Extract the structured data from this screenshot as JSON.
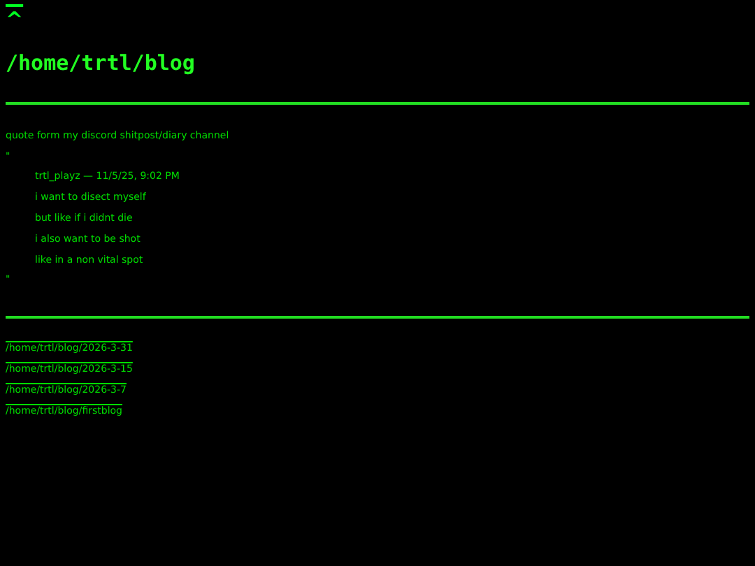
{
  "back_link": "^",
  "title": "/home/trtl/blog",
  "intro": "quote form my discord shitpost/diary channel",
  "quote_open": "\"",
  "quote_lines": [
    "trtl_playz — 11/5/25, 9:02 PM",
    "i want to disect myself",
    "but like if i didnt die",
    "i also want to be shot",
    "like in a non vital spot"
  ],
  "quote_close": "\"",
  "links": [
    "/home/trtl/blog/2026-3-31",
    "/home/trtl/blog/2026-3-15",
    "/home/trtl/blog/2026-3-7",
    "/home/trtl/blog/firstblog"
  ]
}
